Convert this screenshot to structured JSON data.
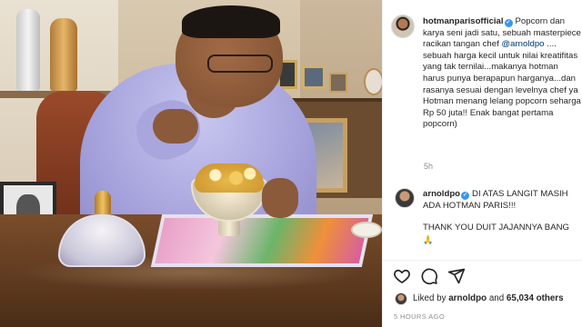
{
  "post": {
    "author": "hotmanparisofficial",
    "caption_text": "Popcorn dan karya seni jadi satu, sebuah masterpiece racikan tangan chef ",
    "caption_mention": "@arnoldpo",
    "caption_rest": " .... sebuah harga kecil untuk nilai kreatifitas yang tak ternilai...makanya hotman harus punya berapapun harganya...dan rasanya sesuai dengan levelnya chef ya Hotman menang lelang popcorn seharga Rp 50 juta!! Enak bangat pertama popcorn)",
    "time": "5h"
  },
  "comment": {
    "author": "arnoldpo",
    "line1": "DI ATAS LANGIT MASIH ADA HOTMAN PARIS!!!",
    "line2": "THANK YOU DUIT JAJANNYA BANG",
    "emoji": "🙏"
  },
  "actions": {
    "like_icon": "heart-icon",
    "comment_icon": "comment-icon",
    "share_icon": "share-icon"
  },
  "likes": {
    "prefix": "Liked by ",
    "user": "arnoldpo",
    "middle": " and ",
    "count": "65,034 others"
  },
  "timestamp": "5 HOURS AGO",
  "colors": {
    "verified": "#3897f0",
    "mention": "#00376b",
    "muted": "#8e8e8e"
  }
}
